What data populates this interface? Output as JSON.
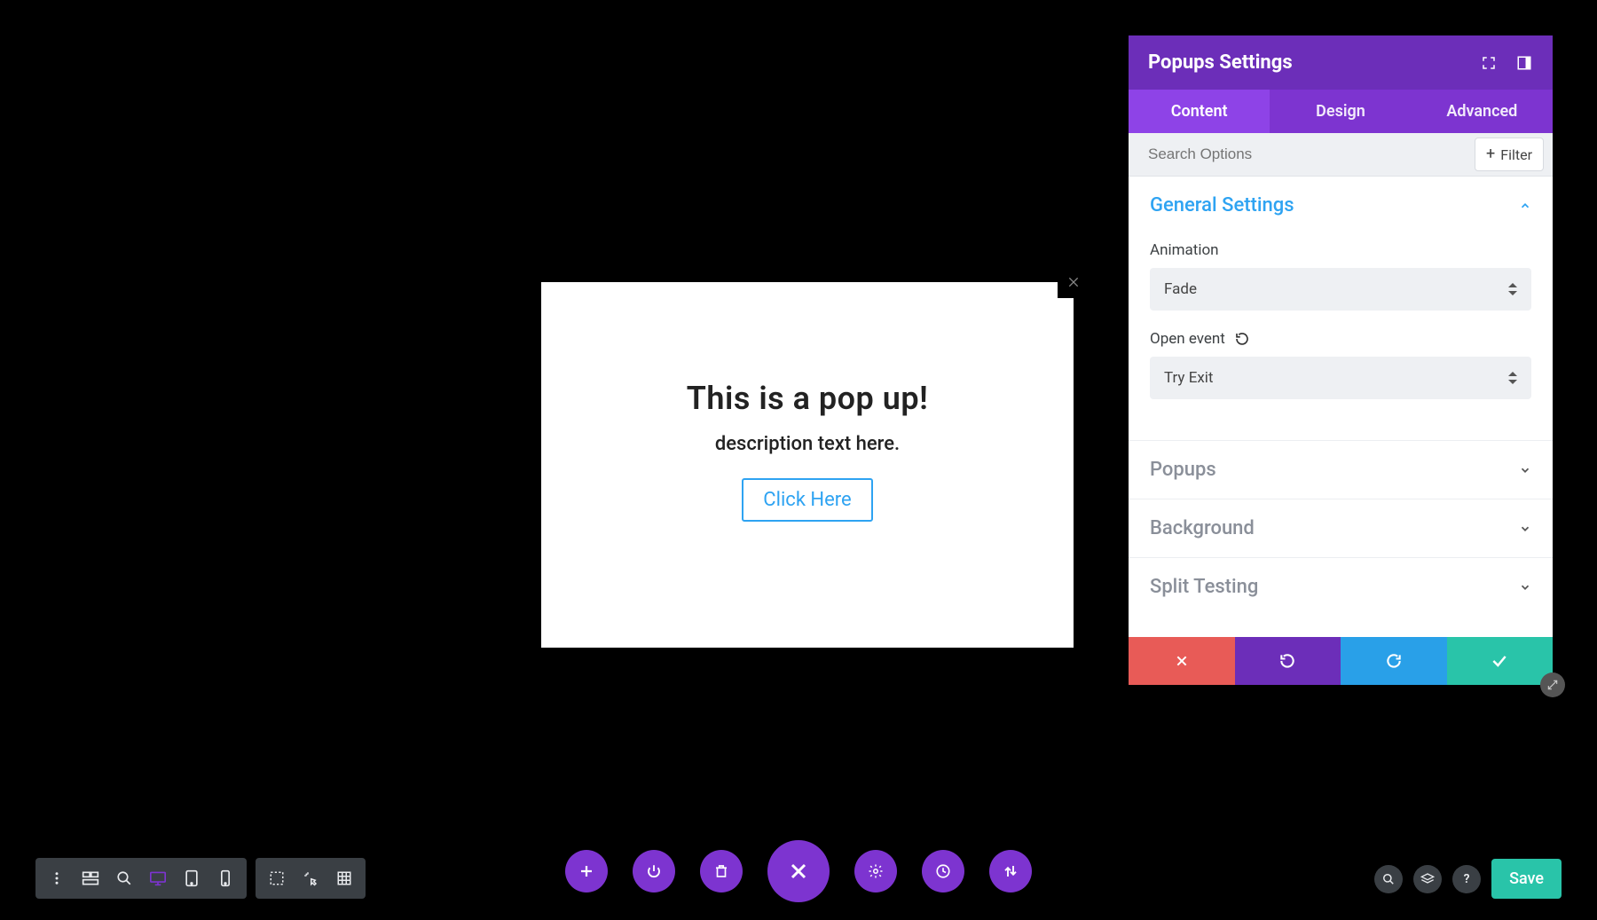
{
  "popup": {
    "title": "This is a pop up!",
    "description": "description text here.",
    "button_label": "Click Here"
  },
  "panel": {
    "title": "Popups Settings",
    "tabs": {
      "content": "Content",
      "design": "Design",
      "advanced": "Advanced"
    },
    "search_placeholder": "Search Options",
    "filter_label": "Filter",
    "sections": {
      "general": {
        "title": "General Settings",
        "animation_label": "Animation",
        "animation_value": "Fade",
        "openevent_label": "Open event",
        "openevent_value": "Try Exit"
      },
      "popups": {
        "title": "Popups"
      },
      "background": {
        "title": "Background"
      },
      "split_testing": {
        "title": "Split Testing"
      }
    }
  },
  "toolbar": {
    "save_label": "Save"
  },
  "colors": {
    "purple": "#7d34d0",
    "header_purple": "#6c2eb9",
    "blue": "#2ea3f2",
    "teal": "#29c4a9",
    "red": "#e85b57"
  }
}
